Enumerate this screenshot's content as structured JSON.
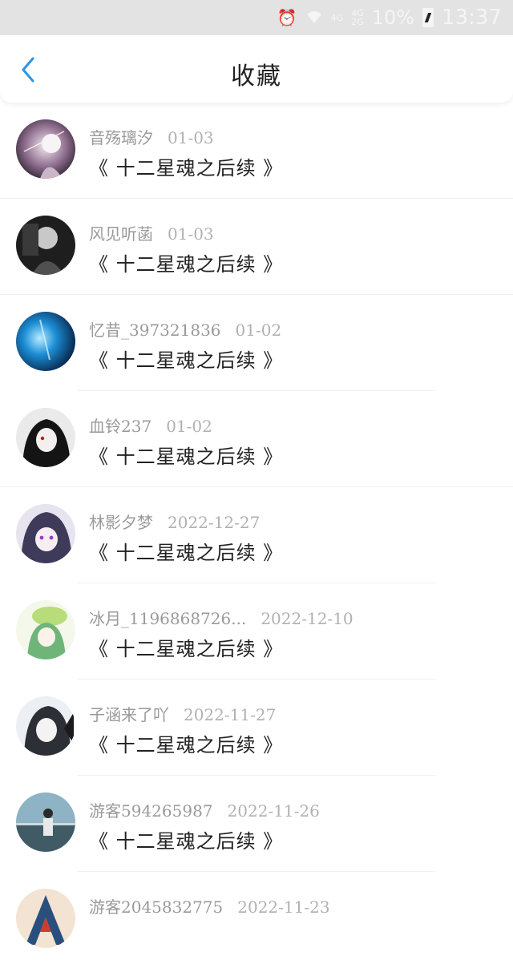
{
  "status_bar": {
    "alarm_icon": "alarm-icon",
    "wifi_icon": "wifi-icon",
    "network_1": "4G",
    "network_2_top": "4G",
    "network_2_bottom": "2G",
    "battery_percent": "10%",
    "time": "13:37"
  },
  "header": {
    "back_icon": "chevron-left-icon",
    "title": "收藏"
  },
  "favorites": [
    {
      "user": "音殇璃汐",
      "date": "01-03",
      "book": "《 十二星魂之后续 》"
    },
    {
      "user": "风见听菡",
      "date": "01-03",
      "book": "《 十二星魂之后续 》"
    },
    {
      "user": "忆昔_397321836",
      "date": "01-02",
      "book": "《 十二星魂之后续 》"
    },
    {
      "user": "血铃237",
      "date": "01-02",
      "book": "《 十二星魂之后续 》"
    },
    {
      "user": "林影夕梦",
      "date": "2022-12-27",
      "book": "《 十二星魂之后续 》"
    },
    {
      "user": "冰月_1196868726...",
      "date": "2022-12-10",
      "book": "《 十二星魂之后续 》"
    },
    {
      "user": "子涵来了吖",
      "date": "2022-11-27",
      "book": "《 十二星魂之后续 》"
    },
    {
      "user": "游客594265987",
      "date": "2022-11-26",
      "book": "《 十二星魂之后续 》"
    },
    {
      "user": "游客2045832775",
      "date": "2022-11-23",
      "book": ""
    }
  ],
  "colors": {
    "accent": "#2a95e8",
    "status_bar_bg": "#e3e3e3",
    "meta_text": "#9a9a9a",
    "title_text": "#222222"
  }
}
